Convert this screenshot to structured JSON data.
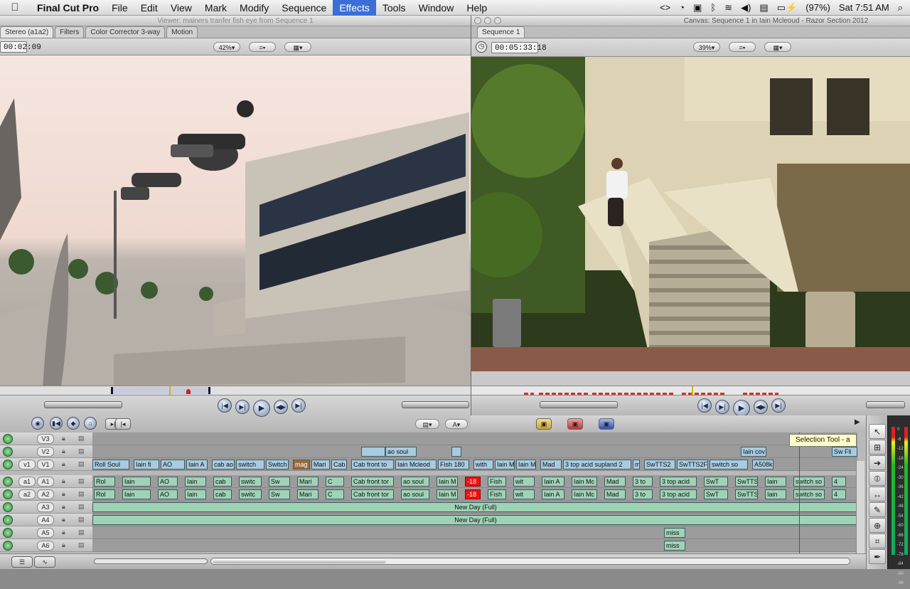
{
  "menubar": {
    "app": "Final Cut Pro",
    "items": [
      "File",
      "Edit",
      "View",
      "Mark",
      "Modify",
      "Sequence",
      "Effects",
      "Tools",
      "Window",
      "Help"
    ],
    "active_item": "Effects",
    "battery": "(97%)",
    "clock": "Sat 7:51 AM"
  },
  "viewer": {
    "title": "Viewer: mainers tranfer fish eye from Sequence 1",
    "tabs": [
      "Stereo (a1a2)",
      "Filters",
      "Color Corrector 3-way",
      "Motion"
    ],
    "timecode": "00:02:09",
    "zoom": "42%"
  },
  "canvas": {
    "title": "Canvas: Sequence 1 in Iain Mcleoud - Razor Section 2012",
    "tab": "Sequence 1",
    "timecode": "00:05:33:18",
    "zoom": "39%"
  },
  "tooltip": "Selection Tool - a",
  "timeline": {
    "tracks": [
      {
        "id": "v3",
        "label": "V3"
      },
      {
        "id": "v2",
        "label": "V2"
      },
      {
        "id": "v1",
        "src": "v1",
        "label": "V1"
      },
      {
        "id": "a1",
        "src": "a1",
        "label": "A1"
      },
      {
        "id": "a2",
        "src": "a2",
        "label": "A2"
      },
      {
        "id": "a3",
        "label": "A3"
      },
      {
        "id": "a4",
        "label": "A4"
      },
      {
        "id": "a5",
        "label": "A5"
      },
      {
        "id": "a6",
        "label": "A6"
      }
    ],
    "v2_clips": [
      "ao soul",
      "Iain cov",
      "Sw Fli"
    ],
    "v1_clips": [
      "Roll Soul",
      "Iain fi",
      "AO",
      "Iain A",
      "cab ao",
      "switch",
      "Switch",
      "mag",
      "Mari",
      "Cab",
      "Cab front to",
      "Iain Mcleod",
      "Fish 180",
      "with",
      "Iain M",
      "Iain M",
      "Mad",
      "3 top acid supland 2",
      "m",
      "SwTTS2",
      "SwTTS2F",
      "switch so",
      "A508k"
    ],
    "a_clips": [
      "Rol",
      "Iain",
      "AO",
      "Iain",
      "cab",
      "switc",
      "Sw",
      "Mari",
      "C",
      "Cab front tor",
      "ao soul",
      "Iain M",
      "-18",
      "Fish",
      "wit",
      "Iain A",
      "Iain Mc",
      "Mad",
      "3 to",
      "3 top acid",
      "SwT",
      "SwTTS",
      "Iain",
      "switch so",
      "4"
    ],
    "a3_label": "New Day (Full)",
    "a4_label": "New Day (Full)",
    "a5_label": "miss",
    "a6_label": "miss",
    "level_badge": "-18"
  },
  "meters": {
    "scale": [
      "0",
      "-6",
      "-12",
      "-18",
      "-24",
      "-30",
      "-36",
      "-42",
      "-48",
      "-54",
      "-60",
      "-66",
      "-72",
      "-78",
      "-84",
      "-90",
      "-96"
    ]
  }
}
